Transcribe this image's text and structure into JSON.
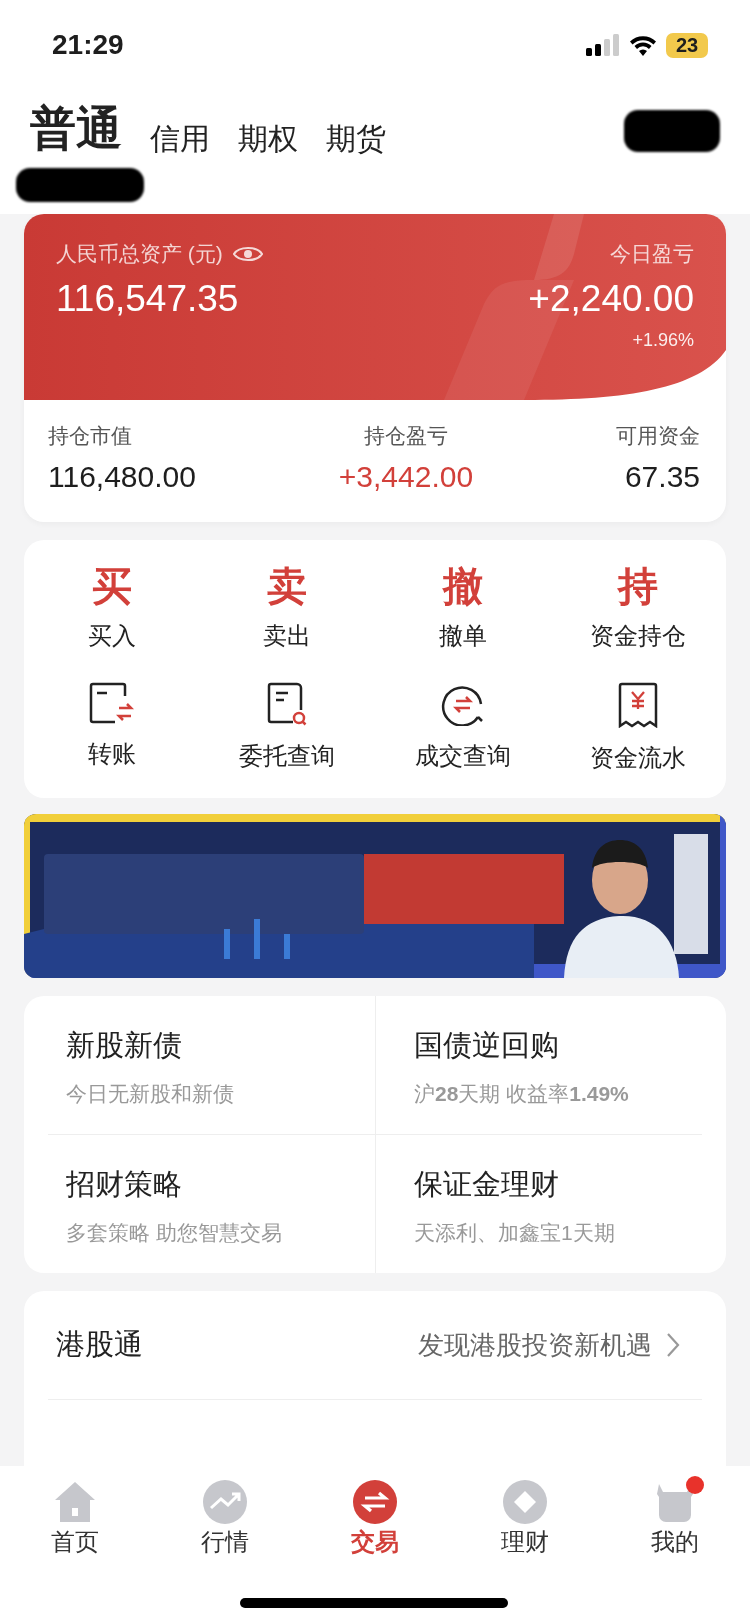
{
  "status_bar": {
    "time": "21:29",
    "battery": "23"
  },
  "account_tabs": [
    {
      "label": "普通",
      "selected": true
    },
    {
      "label": "信用",
      "selected": false
    },
    {
      "label": "期权",
      "selected": false
    },
    {
      "label": "期货",
      "selected": false
    }
  ],
  "asset_card": {
    "total_label": "人民币总资产 (元)",
    "total": "116,547.35",
    "today_label": "今日盈亏",
    "today_value": "+2,240.00",
    "today_percent": "+1.96%"
  },
  "stats": [
    {
      "label": "持仓市值",
      "value": "116,480.00",
      "kind": "plain"
    },
    {
      "label": "持仓盈亏",
      "value": "+3,442.00",
      "kind": "gain"
    },
    {
      "label": "可用资金",
      "value": "67.35",
      "kind": "plain"
    }
  ],
  "trade_actions": [
    {
      "glyph": "买",
      "label": "买入"
    },
    {
      "glyph": "卖",
      "label": "卖出"
    },
    {
      "glyph": "撤",
      "label": "撤单"
    },
    {
      "glyph": "持",
      "label": "资金持仓"
    }
  ],
  "tools": [
    {
      "kind": "transfer",
      "label": "转账"
    },
    {
      "kind": "order-query",
      "label": "委托查询"
    },
    {
      "kind": "deal-query",
      "label": "成交查询"
    },
    {
      "kind": "cash-flow",
      "label": "资金流水"
    }
  ],
  "services": [
    {
      "title": "新股新债",
      "subtitle": "今日无新股和新债"
    },
    {
      "title": "国债逆回购",
      "subtitle": "沪**28**天期 收益率**1.49%**"
    },
    {
      "title": "招财策略",
      "subtitle": "多套策略 助您智慧交易"
    },
    {
      "title": "保证金理财",
      "subtitle": "天添利、加鑫宝1天期"
    }
  ],
  "hk_connect": {
    "title": "港股通",
    "link": "发现港股投资新机遇"
  },
  "bottom_nav": [
    {
      "kind": "home",
      "label": "首页",
      "selected": false,
      "badge": false
    },
    {
      "kind": "market",
      "label": "行情",
      "selected": false,
      "badge": false
    },
    {
      "kind": "trade",
      "label": "交易",
      "selected": true,
      "badge": false
    },
    {
      "kind": "wealth",
      "label": "理财",
      "selected": false,
      "badge": false
    },
    {
      "kind": "profile",
      "label": "我的",
      "selected": false,
      "badge": true
    }
  ]
}
